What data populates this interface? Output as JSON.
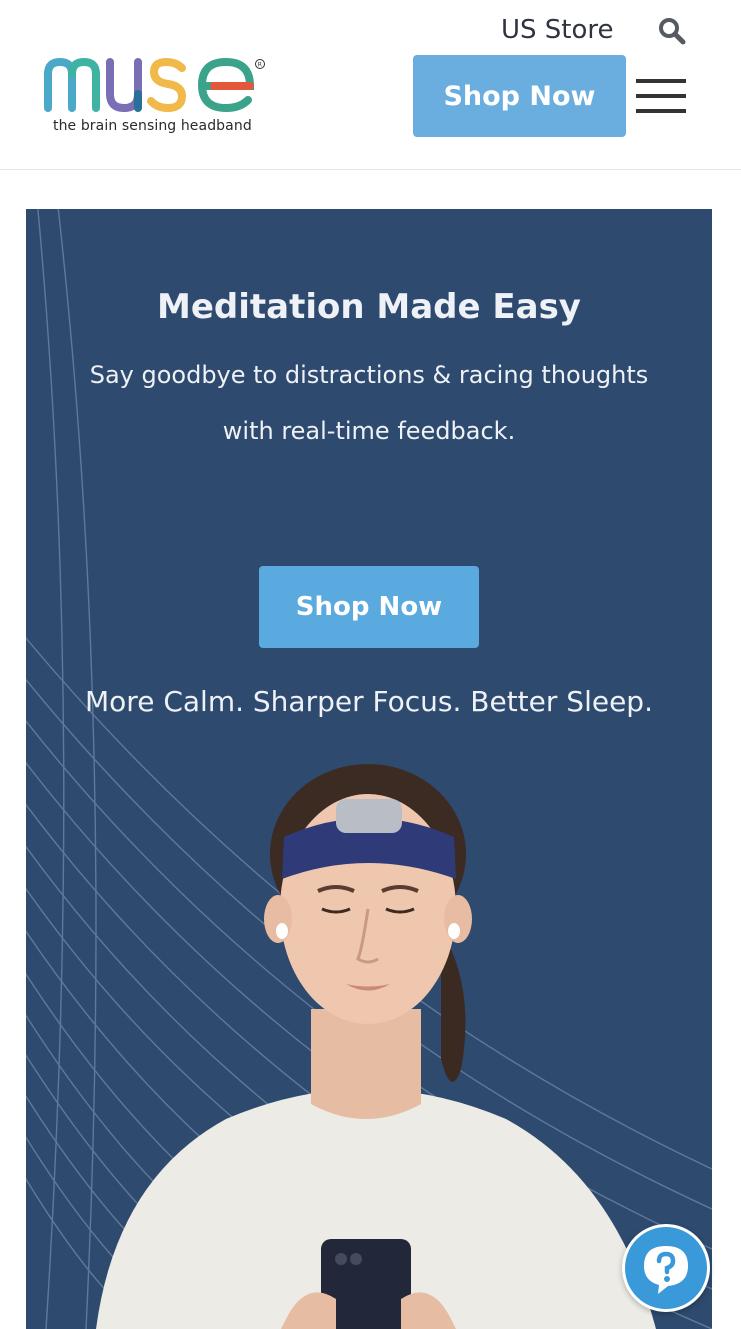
{
  "header": {
    "logo_text": "muse",
    "logo_tagline": "the brain sensing headband",
    "store_label": "US Store",
    "shop_button": "Shop Now",
    "icons": [
      "search-icon",
      "hamburger-menu-icon"
    ]
  },
  "hero": {
    "title": "Meditation Made Easy",
    "subtitle": "Say goodbye to distractions & racing thoughts with real-time feedback.",
    "shop_button": "Shop Now",
    "tagline": "More Calm. Sharper Focus. Better Sleep."
  },
  "help": {
    "icon": "question-chat-icon"
  },
  "colors": {
    "accent": "#6aaee0",
    "hero_background": "#2e4a6f",
    "logo_m": "#4aa8c8",
    "logo_u": "#7a6fb5",
    "logo_s": "#f0b94a",
    "logo_e": "#e3573b"
  }
}
